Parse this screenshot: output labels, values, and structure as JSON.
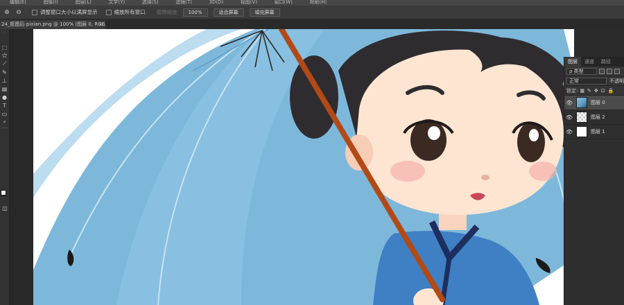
{
  "menubar": {
    "items": [
      "编辑(E)",
      "图像(I)",
      "图层(L)",
      "文字(Y)",
      "选择(S)",
      "滤镜(T)",
      "3D(D)",
      "视图(V)",
      "窗口(W)",
      "帮助(H)"
    ]
  },
  "options": {
    "resize_windows_label": "调整窗口大小以满屏显示",
    "zoom_all_label": "缩放所有窗口",
    "scrubby_label": "细微缩放",
    "zoom_value": "100%",
    "fit_screen_label": "适合屏幕",
    "fill_screen_label": "填充屏幕"
  },
  "document": {
    "tab_title": "24_抠图后-pixian.png @ 100% (图层 0, RGB/8) *",
    "close_symbol": "×"
  },
  "tools": {
    "items": [
      {
        "icon": "marquee-icon",
        "glyph": "⬚"
      },
      {
        "icon": "magic-wand-icon",
        "glyph": "⚝"
      },
      {
        "icon": "eyedropper-icon",
        "glyph": "⟋"
      },
      {
        "icon": "brush-icon",
        "glyph": "✎"
      },
      {
        "icon": "stamp-icon",
        "glyph": "⊥"
      },
      {
        "icon": "gradient-icon",
        "glyph": "▤"
      },
      {
        "icon": "dodge-icon",
        "glyph": "●"
      },
      {
        "icon": "type-icon",
        "glyph": "T"
      },
      {
        "icon": "rectangle-icon",
        "glyph": "▭"
      },
      {
        "icon": "zoom-icon",
        "glyph": "🔍"
      }
    ]
  },
  "layers_panel": {
    "tabs": [
      "图层",
      "通道",
      "路径"
    ],
    "filter_label": "ρ 类型",
    "blend_mode": "正常",
    "opacity_label": "不透明",
    "lock_label": "锁定:",
    "layers": [
      {
        "name": "图层 0",
        "thumb": "photo",
        "active": true
      },
      {
        "name": "图层 2",
        "thumb": "checker",
        "active": false
      },
      {
        "name": "图层 1",
        "thumb": "white",
        "active": false
      }
    ]
  },
  "colors": {
    "umbrella": "#7db8db",
    "umbrella_dark": "#4f8fbe",
    "hair": "#2f2c30",
    "skin": "#fde5d2",
    "robe": "#3f7fc4",
    "robe_trim": "#1d2f5f",
    "handle": "#b24a17"
  }
}
